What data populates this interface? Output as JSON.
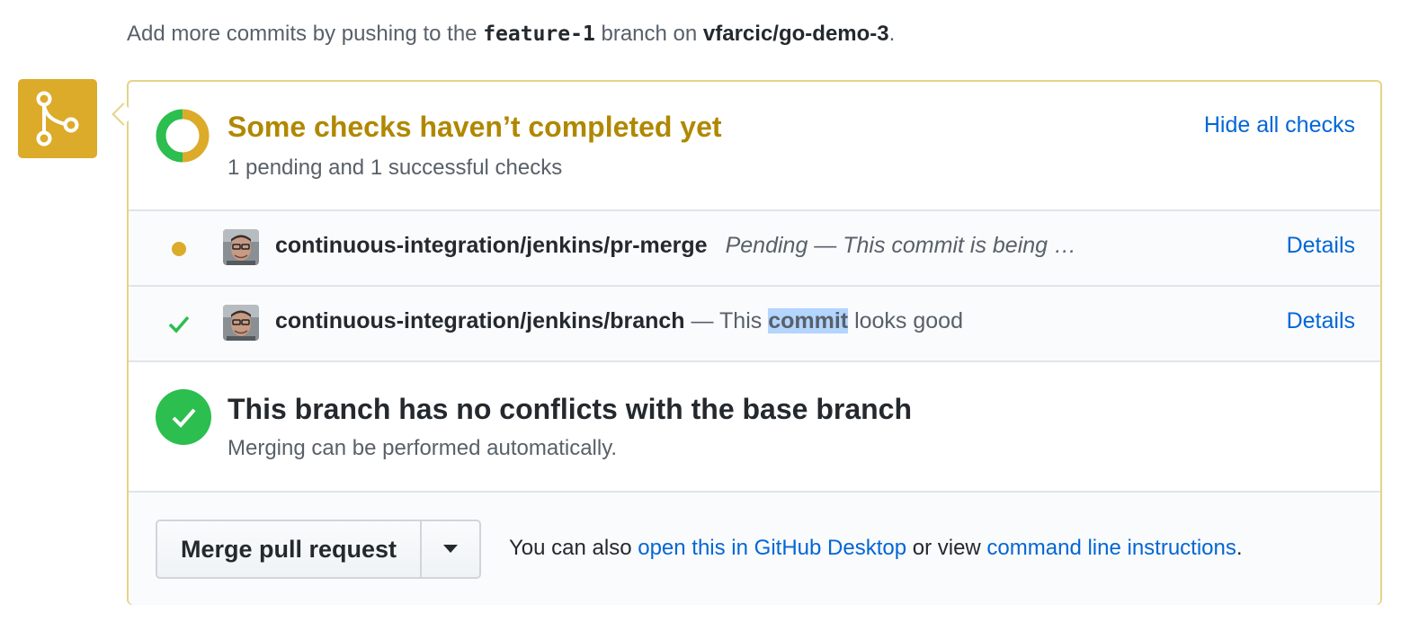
{
  "top_note": {
    "prefix": "Add more commits by pushing to the ",
    "branch": "feature-1",
    "middle": " branch on ",
    "repo": "vfarcic/go-demo-3",
    "suffix": "."
  },
  "checks": {
    "title": "Some checks haven’t completed yet",
    "subtitle": "1 pending and 1 successful checks",
    "toggle_label": "Hide all checks",
    "donut": {
      "success_fraction": 0.5,
      "pending_fraction": 0.5
    },
    "items": [
      {
        "context": "continuous-integration/jenkins/pr-merge",
        "state": "pending",
        "description": "Pending — This commit is being …",
        "details_label": "Details"
      },
      {
        "context": "continuous-integration/jenkins/branch",
        "state": "success",
        "description_prefix": " — This ",
        "description_highlight": "commit",
        "description_suffix": " looks good",
        "details_label": "Details"
      }
    ]
  },
  "merge_status": {
    "title": "This branch has no conflicts with the base branch",
    "subtitle": "Merging can be performed automatically."
  },
  "merge_actions": {
    "merge_button_label": "Merge pull request",
    "alt_prefix": "You can also ",
    "desktop_link": "open this in GitHub Desktop",
    "alt_middle": " or view ",
    "cli_link": "command line instructions",
    "alt_suffix": "."
  },
  "colors": {
    "pending": "#dbab29",
    "success": "#2cbe4e",
    "link": "#0366d6",
    "pending_title": "#b08800"
  }
}
